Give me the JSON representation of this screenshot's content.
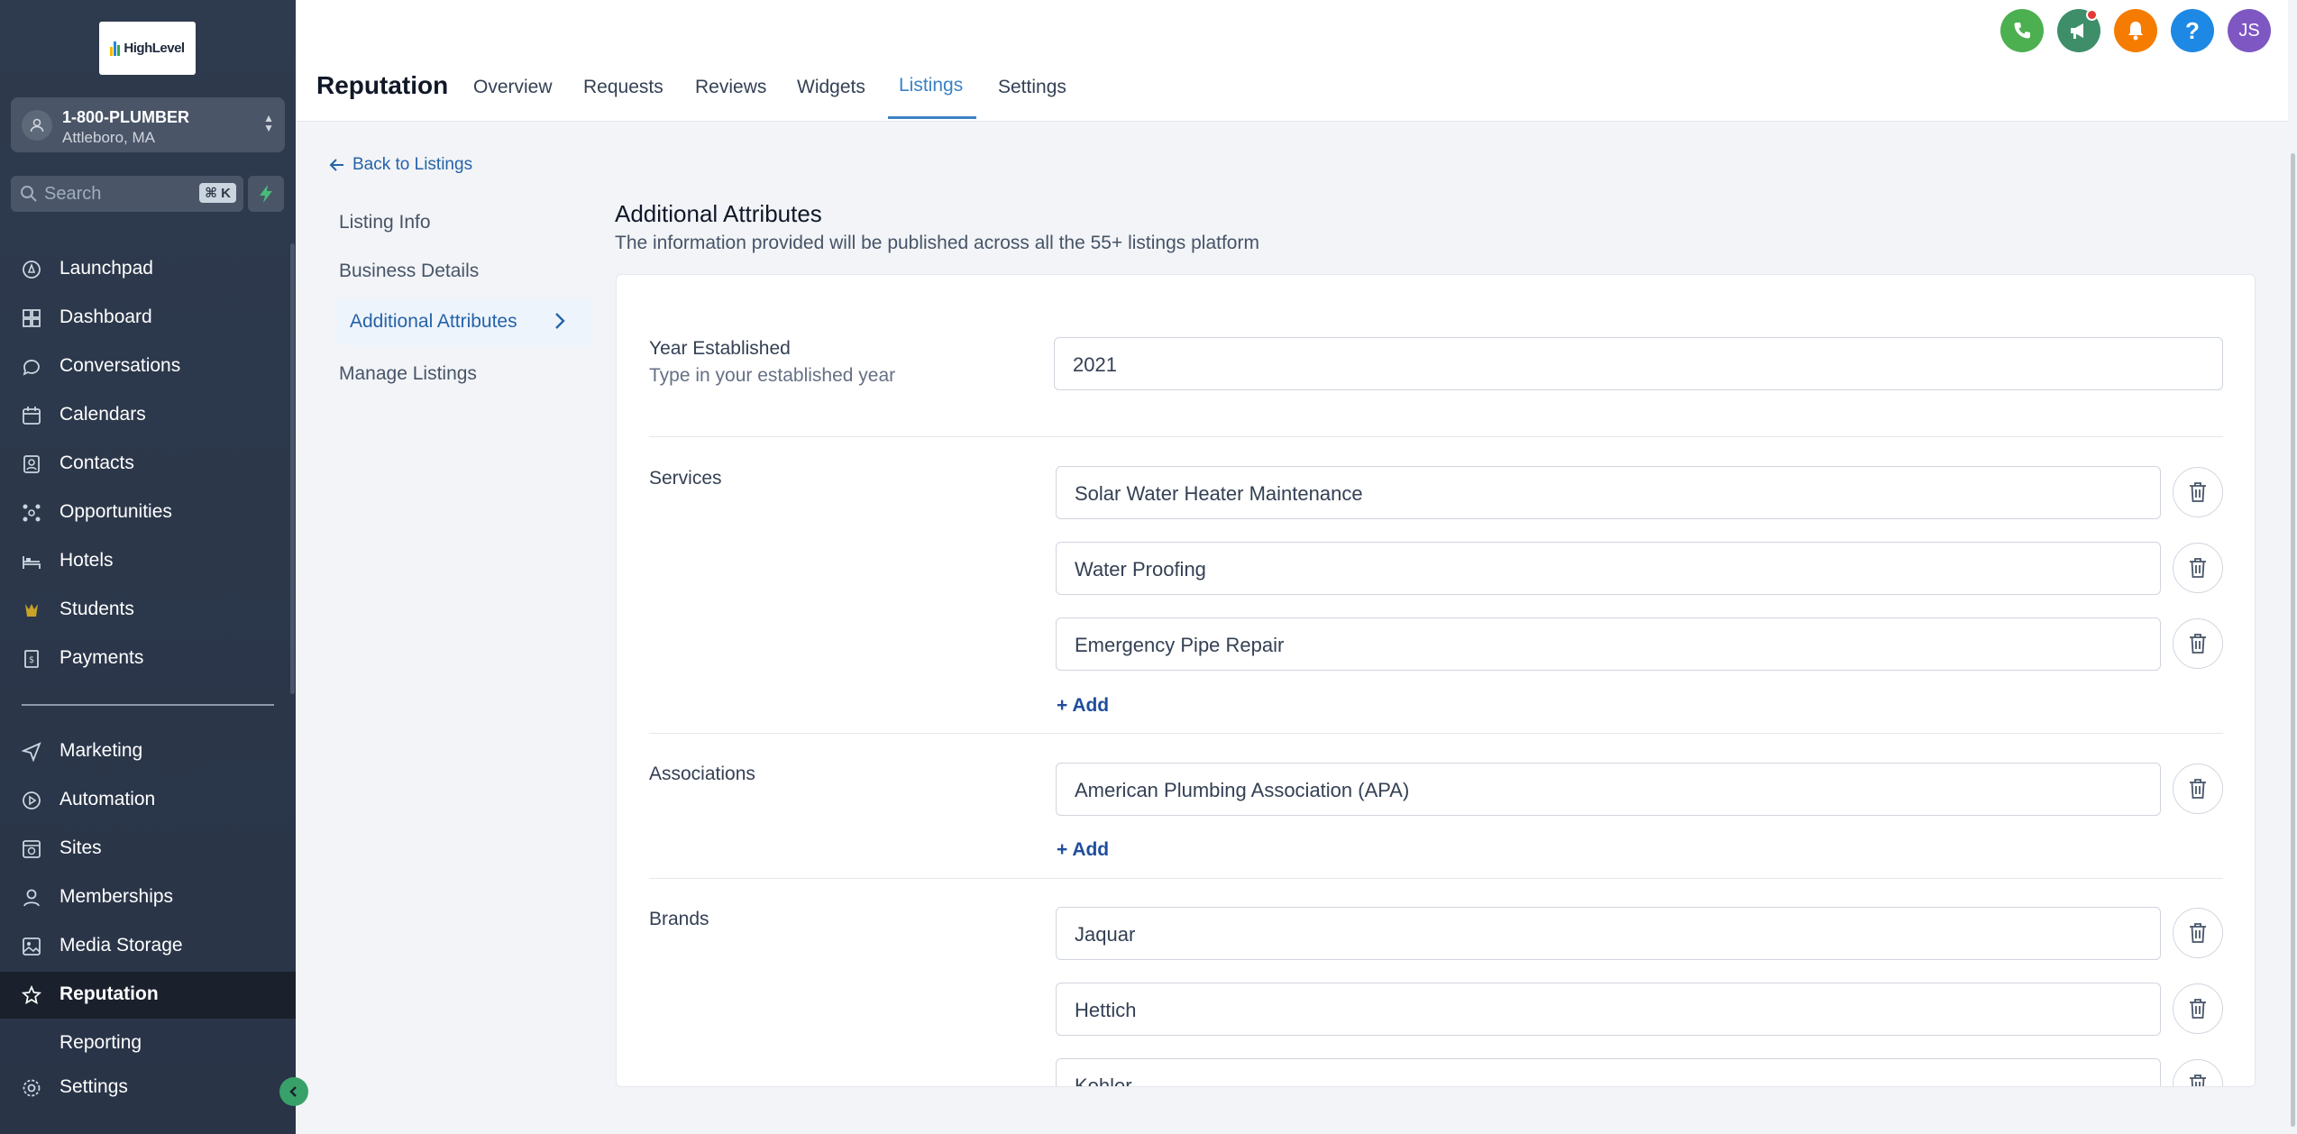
{
  "brand": {
    "logo_text": "HighLevel"
  },
  "account": {
    "name": "1-800-PLUMBER",
    "location": "Attleboro, MA"
  },
  "search": {
    "placeholder": "Search",
    "shortcut": "⌘ K"
  },
  "sidebar": {
    "items": [
      {
        "label": "Launchpad",
        "icon": "rocket-icon"
      },
      {
        "label": "Dashboard",
        "icon": "dashboard-icon"
      },
      {
        "label": "Conversations",
        "icon": "chat-icon"
      },
      {
        "label": "Calendars",
        "icon": "calendar-icon"
      },
      {
        "label": "Contacts",
        "icon": "contacts-icon"
      },
      {
        "label": "Opportunities",
        "icon": "opportunities-icon"
      },
      {
        "label": "Hotels",
        "icon": "bed-icon"
      },
      {
        "label": "Students",
        "icon": "students-icon"
      },
      {
        "label": "Payments",
        "icon": "payments-icon"
      }
    ],
    "items2": [
      {
        "label": "Marketing",
        "icon": "send-icon"
      },
      {
        "label": "Automation",
        "icon": "automation-icon"
      },
      {
        "label": "Sites",
        "icon": "sites-icon"
      },
      {
        "label": "Memberships",
        "icon": "memberships-icon"
      },
      {
        "label": "Media Storage",
        "icon": "image-icon"
      },
      {
        "label": "Reputation",
        "icon": "star-icon",
        "active": true
      }
    ],
    "partial_label": "Reporting",
    "settings_label": "Settings"
  },
  "header": {
    "title": "Reputation",
    "tabs": [
      "Overview",
      "Requests",
      "Reviews",
      "Widgets",
      "Listings",
      "Settings"
    ],
    "active_tab": "Listings",
    "avatar_initials": "JS"
  },
  "subnav": {
    "back_label": "Back to Listings",
    "items": [
      "Listing Info",
      "Business Details",
      "Additional Attributes",
      "Manage Listings"
    ],
    "active": "Additional Attributes"
  },
  "section": {
    "title": "Additional Attributes",
    "description": "The information provided will be published across all the 55+ listings platform"
  },
  "form": {
    "year": {
      "label": "Year Established",
      "sublabel": "Type in your established year",
      "value": "2021"
    },
    "services": {
      "label": "Services",
      "values": [
        "Solar Water Heater Maintenance",
        "Water Proofing",
        "Emergency Pipe Repair"
      ]
    },
    "associations": {
      "label": "Associations",
      "values": [
        "American Plumbing Association (APA)"
      ]
    },
    "brands": {
      "label": "Brands",
      "values": [
        "Jaquar",
        "Hettich",
        "Kohler"
      ]
    },
    "add_label": "+ Add"
  },
  "colors": {
    "sidebar_bg": "#2e3a4d",
    "accent": "#3b82c4",
    "phone_green": "#4caf50",
    "notify_orange": "#f57c00",
    "help_blue": "#1e88e5",
    "avatar_purple": "#7e57c2"
  }
}
